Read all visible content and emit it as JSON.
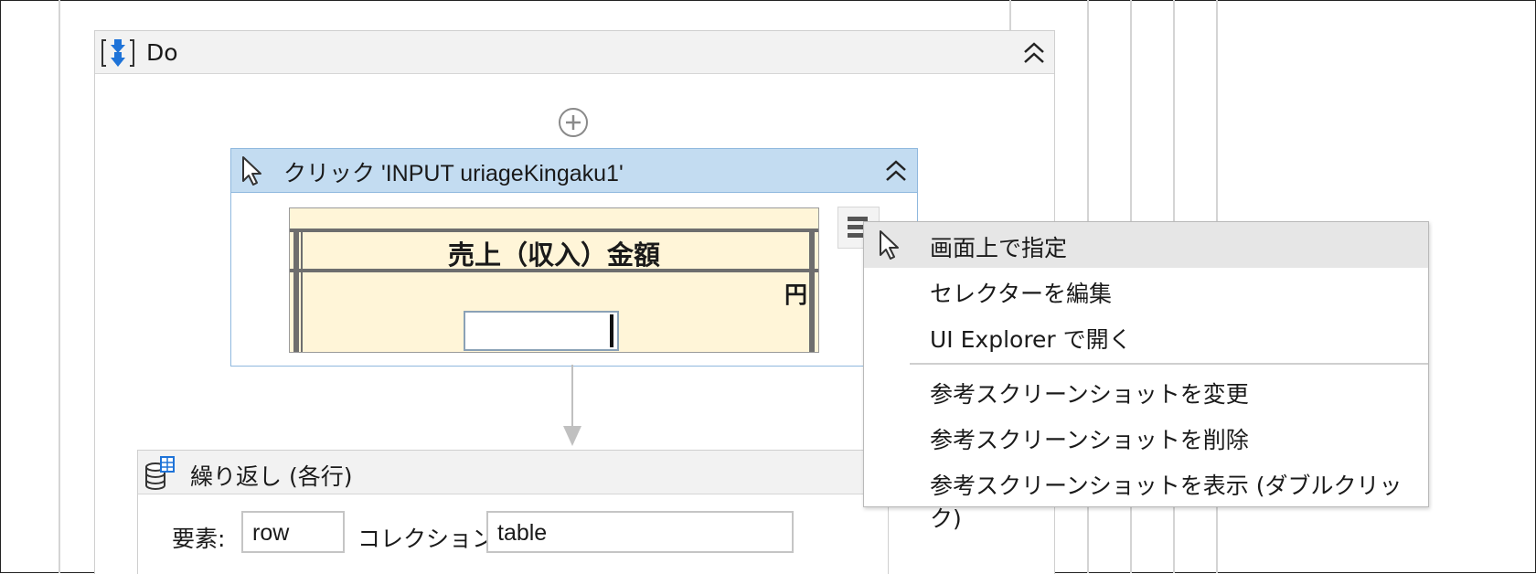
{
  "do_sequence": {
    "title": "Do"
  },
  "click_activity": {
    "title": "クリック 'INPUT  uriageKingaku1'"
  },
  "screenshot": {
    "heading": "売上（収入）金額",
    "unit": "円"
  },
  "foreach_activity": {
    "title": "繰り返し (各行)",
    "element_label": "要素:",
    "element_value": "row",
    "collection_label": "コレクション:",
    "collection_value": "table"
  },
  "context_menu": {
    "items": [
      {
        "label": "画面上で指定",
        "icon": "cursor-icon",
        "highlighted": true
      },
      {
        "label": "セレクターを編集"
      },
      {
        "label": "UI Explorer で開く"
      },
      {
        "label": "参考スクリーンショットを変更"
      },
      {
        "label": "参考スクリーンショットを削除"
      },
      {
        "label": "参考スクリーンショットを表示 (ダブルクリック)"
      }
    ]
  },
  "colors": {
    "activity_header": "#c3dcf1",
    "activity_border": "#8fb8de",
    "screenshot_bg": "#fff5d8",
    "menu_highlight": "#e6e6e6",
    "icon_blue": "#1e73d8"
  }
}
